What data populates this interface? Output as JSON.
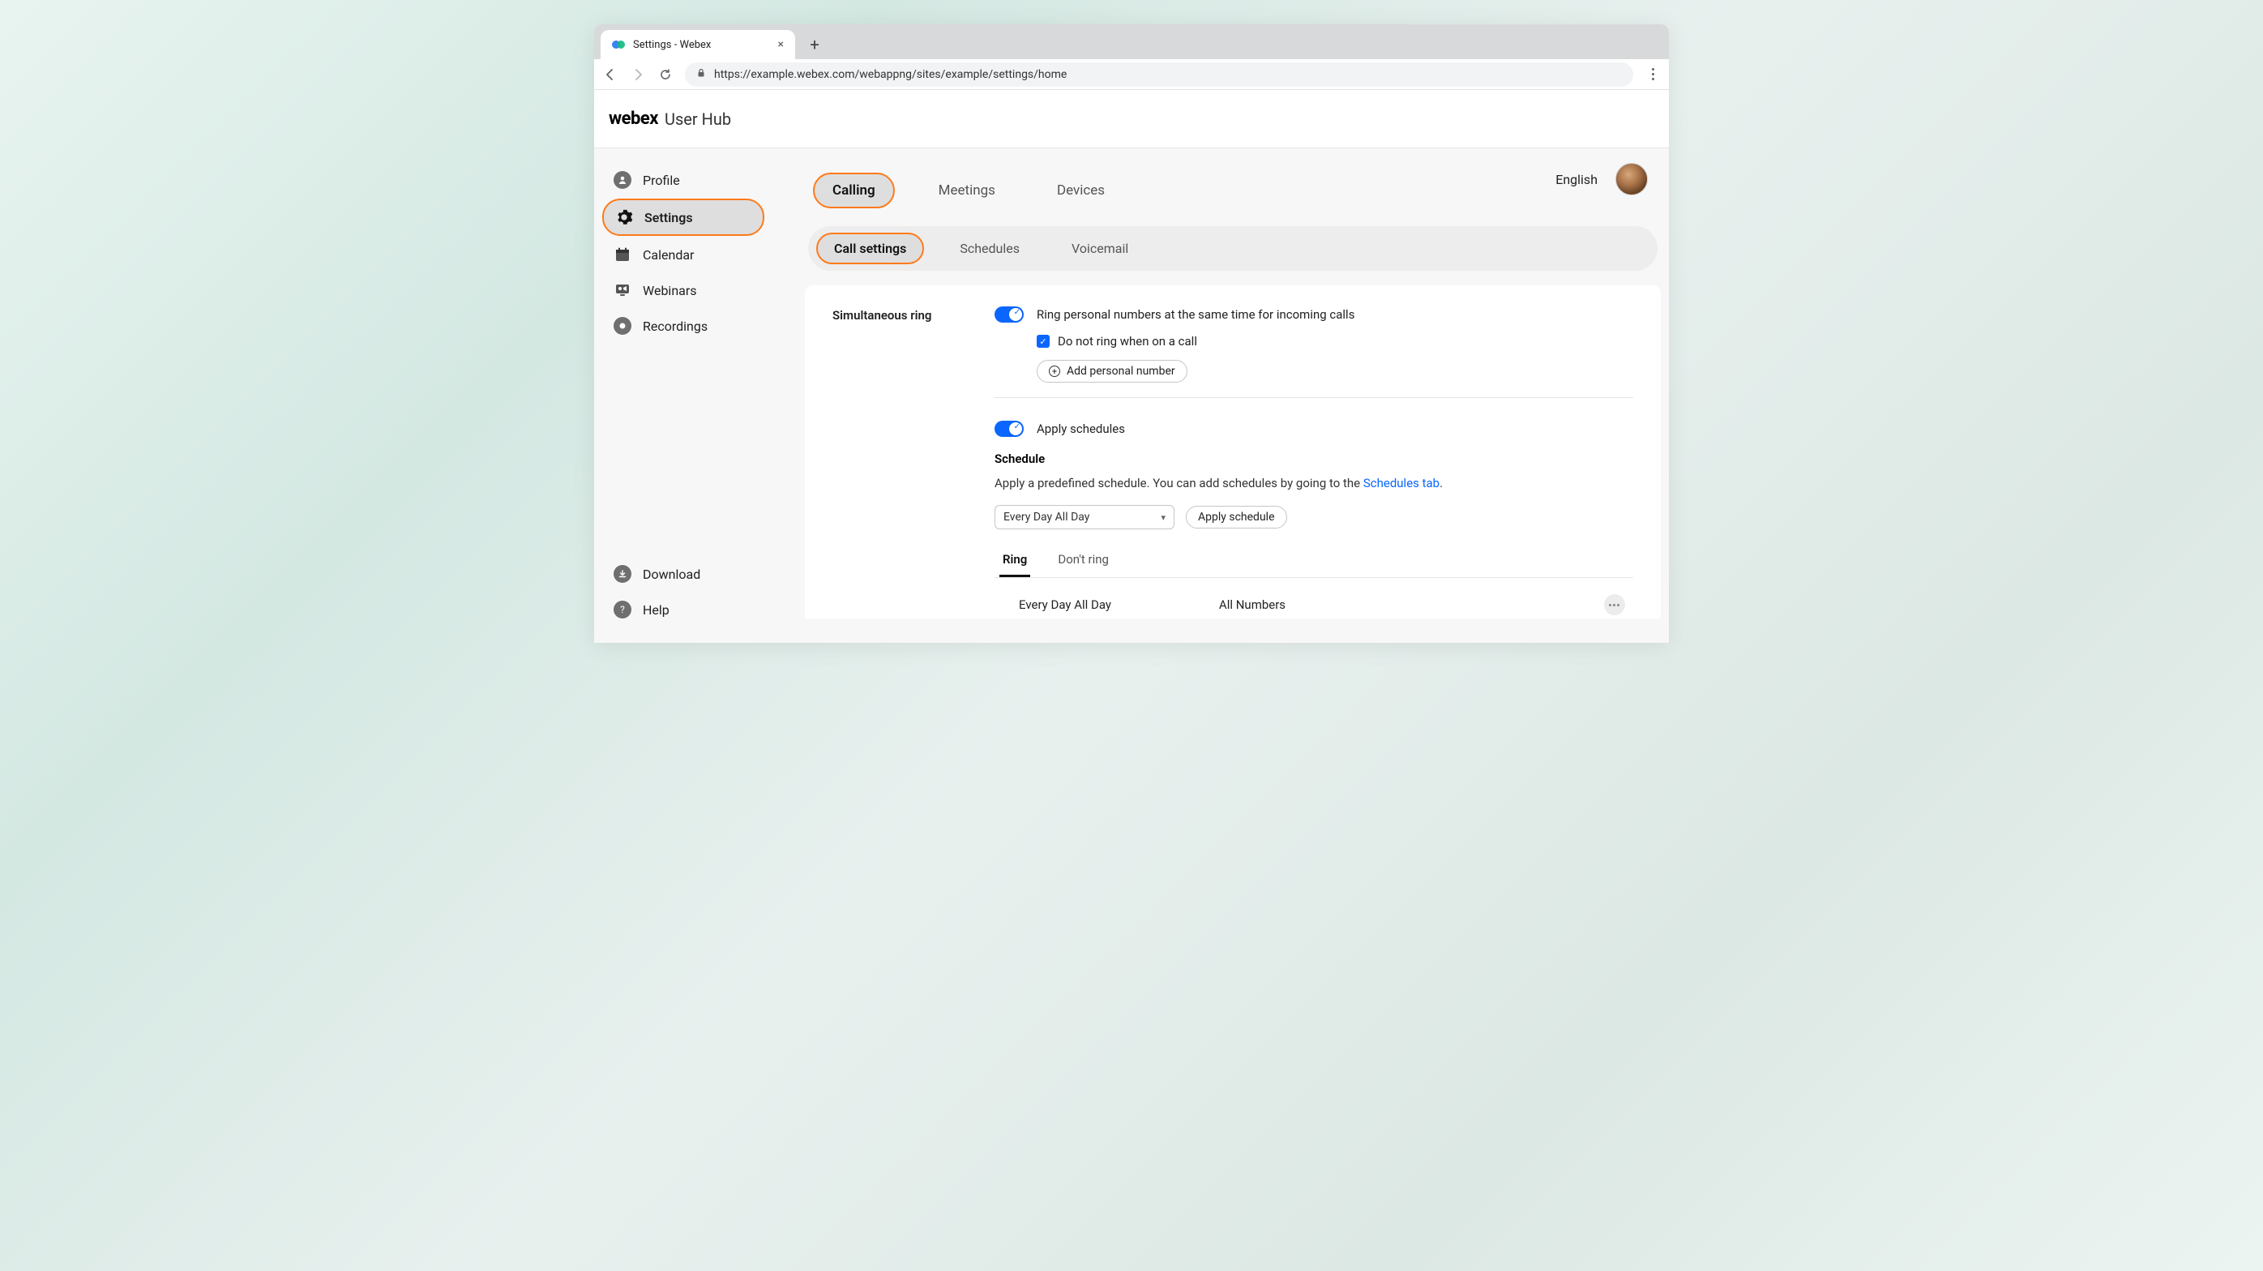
{
  "browser": {
    "tab_title": "Settings - Webex",
    "url": "https://example.webex.com/webappng/sites/example/settings/home"
  },
  "header": {
    "logo": "webex",
    "hub": "User Hub",
    "language": "English"
  },
  "sidebar": {
    "items": [
      {
        "label": "Profile"
      },
      {
        "label": "Settings"
      },
      {
        "label": "Calendar"
      },
      {
        "label": "Webinars"
      },
      {
        "label": "Recordings"
      }
    ],
    "bottom": [
      {
        "label": "Download"
      },
      {
        "label": "Help"
      }
    ]
  },
  "primary_tabs": {
    "calling": "Calling",
    "meetings": "Meetings",
    "devices": "Devices"
  },
  "sub_tabs": {
    "call_settings": "Call settings",
    "schedules": "Schedules",
    "voicemail": "Voicemail"
  },
  "panel": {
    "title": "Simultaneous ring",
    "toggle1_label": "Ring personal numbers at the same time for incoming calls",
    "checkbox_label": "Do not ring when on a call",
    "add_button": "Add personal number",
    "toggle2_label": "Apply schedules",
    "schedule_heading": "Schedule",
    "schedule_desc_prefix": "Apply a predefined schedule. You can add schedules by going to the ",
    "schedule_desc_link": "Schedules tab",
    "schedule_desc_suffix": ".",
    "select_value": "Every Day All Day",
    "apply_button": "Apply schedule",
    "ring_tab": "Ring",
    "dont_ring_tab": "Don't ring",
    "row_schedule": "Every Day All Day",
    "row_numbers": "All Numbers"
  }
}
